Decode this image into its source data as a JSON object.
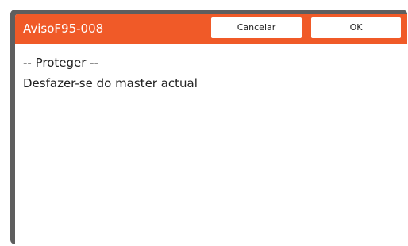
{
  "dialog": {
    "title": "AvisoF95-008",
    "buttons": {
      "cancel_label": "Cancelar",
      "ok_label": "OK"
    },
    "message": {
      "line1": "-- Proteger --",
      "line2": "Desfazer-se do master actual"
    }
  },
  "colors": {
    "header": "#f05a28",
    "frame": "#5e5e5e",
    "background": "#ffffff"
  }
}
